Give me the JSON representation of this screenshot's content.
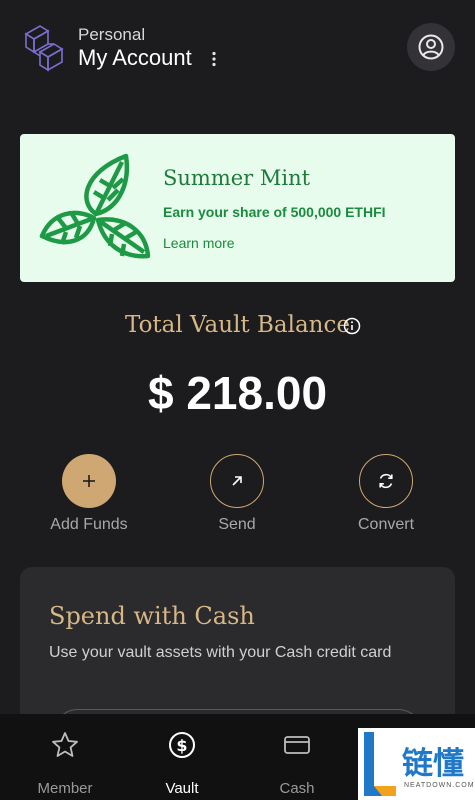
{
  "header": {
    "account_type": "Personal",
    "account_name": "My Account",
    "menu_icon": "kebab-menu-icon",
    "profile_icon": "user-circle-icon"
  },
  "promo": {
    "title": "Summer Mint",
    "subtitle": "Earn your share of 500,000 ETHFI",
    "link": "Learn more",
    "accent_color": "#1b8b3f",
    "background_color": "#e7fcec"
  },
  "balance": {
    "label": "Total Vault Balance",
    "amount": "$ 218.00"
  },
  "actions": [
    {
      "label": "Add Funds",
      "icon": "plus-icon"
    },
    {
      "label": "Send",
      "icon": "arrow-up-right-icon"
    },
    {
      "label": "Convert",
      "icon": "refresh-icon"
    }
  ],
  "spend_card": {
    "title": "Spend with Cash",
    "description": "Use your vault assets with your Cash credit card"
  },
  "nav": {
    "items": [
      {
        "label": "Member",
        "icon": "star-icon",
        "active": false
      },
      {
        "label": "Vault",
        "icon": "dollar-circle-icon",
        "active": true
      },
      {
        "label": "Cash",
        "icon": "credit-card-icon",
        "active": false
      }
    ]
  },
  "watermark": {
    "text": "链懂",
    "subtext": "NEATDOWN.COM"
  },
  "colors": {
    "background": "#1c1b1d",
    "gold": "#cfa772",
    "card": "#2b2a2c"
  }
}
